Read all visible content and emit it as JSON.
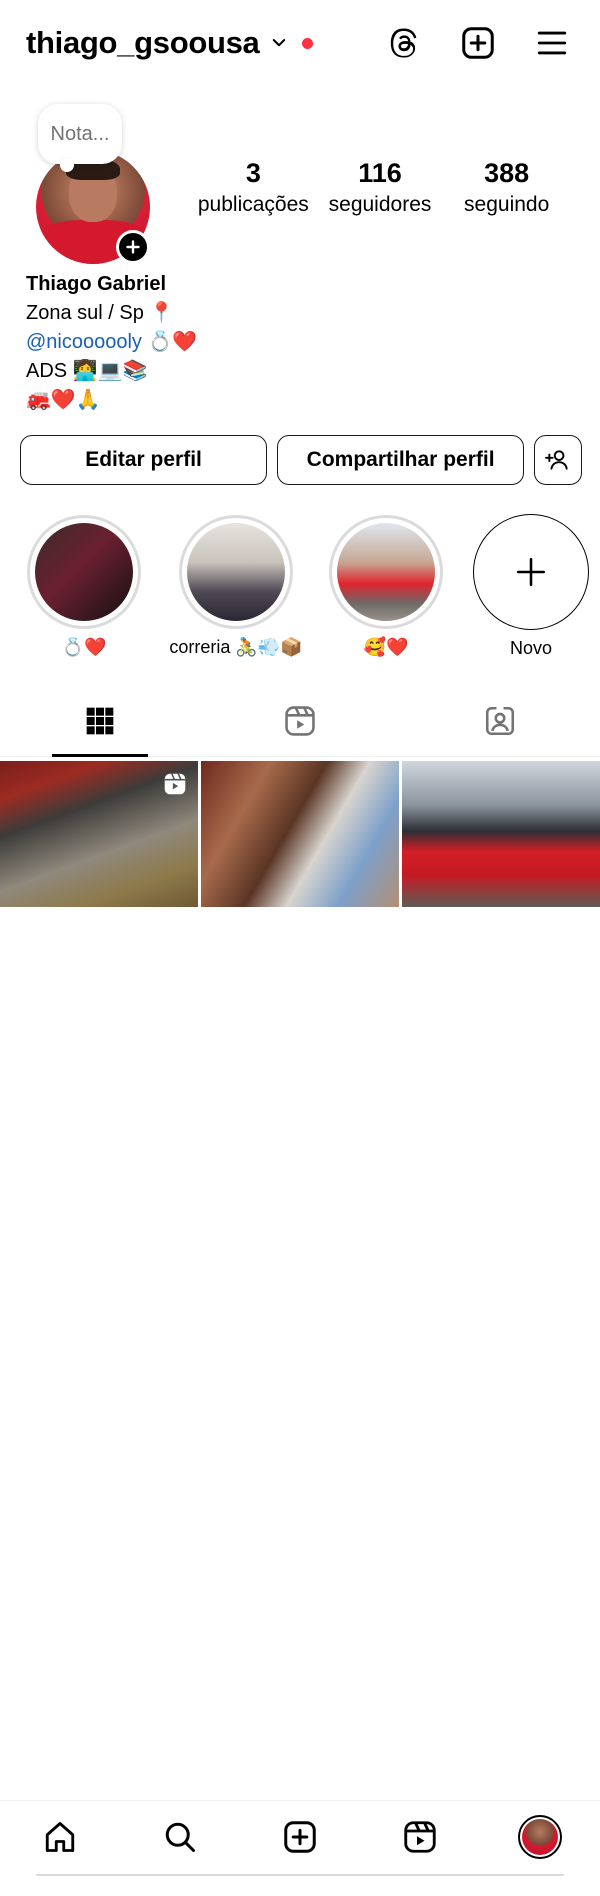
{
  "header": {
    "username": "thiago_gsoousa",
    "icons": [
      "chevron-down-icon",
      "threads-icon",
      "add-post-icon",
      "hamburger-menu-icon"
    ],
    "notification_dot_color": "#ff3040"
  },
  "profile": {
    "note_text": "Nota...",
    "stats": [
      {
        "value": "3",
        "label": "publicações"
      },
      {
        "value": "116",
        "label": "seguidores"
      },
      {
        "value": "388",
        "label": "seguindo"
      }
    ]
  },
  "bio": {
    "name": "Thiago Gabriel",
    "line1": "Zona sul / Sp 📍",
    "mention": "@nicoooooly",
    "mention_suffix": " 💍❤️",
    "line3": "ADS 👩‍💻💻📚",
    "line4": "🚒❤️🙏"
  },
  "actions": {
    "edit_label": "Editar perfil",
    "share_label": "Compartilhar perfil"
  },
  "highlights": [
    {
      "caption": "💍❤️"
    },
    {
      "caption": "correria 🚴💨📦"
    },
    {
      "caption": "🥰❤️"
    },
    {
      "caption": "Novo"
    }
  ],
  "tabs": [
    "grid-icon",
    "reels-icon",
    "tagged-icon"
  ],
  "grid": {
    "posts": [
      {
        "type": "reel"
      },
      {
        "type": "photo"
      },
      {
        "type": "photo"
      }
    ]
  },
  "bottom_nav": [
    "home-icon",
    "search-icon",
    "create-icon",
    "reels-icon",
    "profile-avatar"
  ]
}
